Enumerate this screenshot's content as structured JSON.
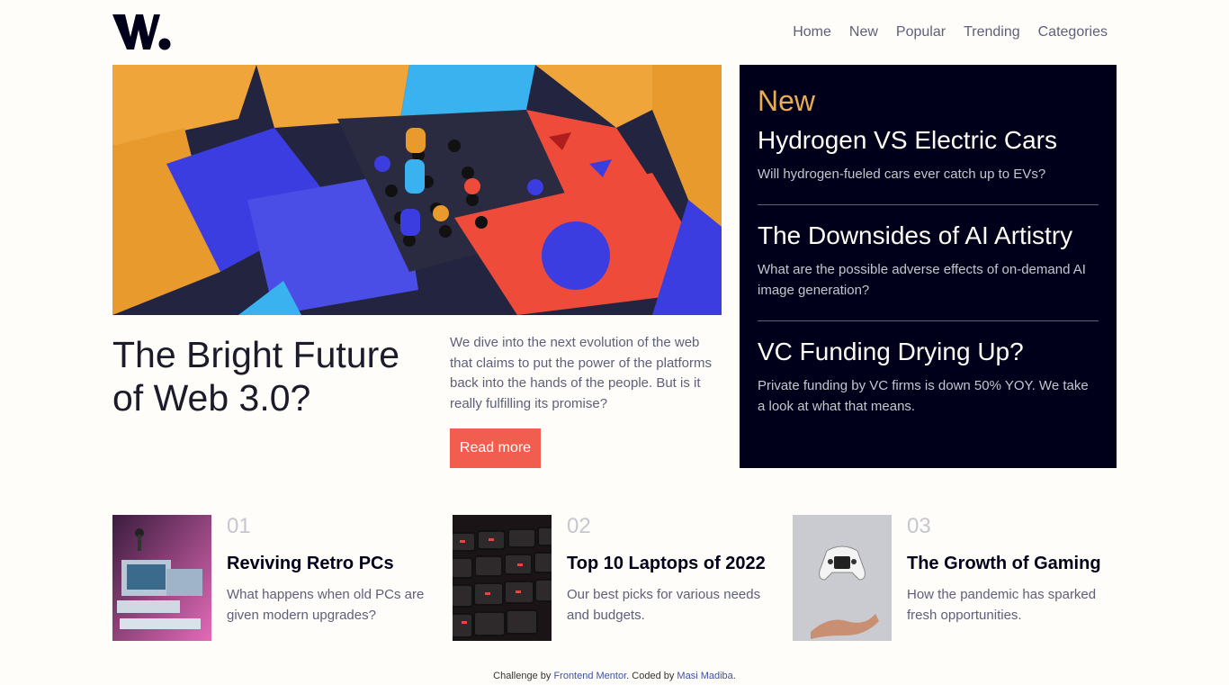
{
  "brand": {
    "logo_text": "W."
  },
  "nav": {
    "items": [
      "Home",
      "New",
      "Popular",
      "Trending",
      "Categories"
    ]
  },
  "hero": {
    "title": "The Bright Future of Web 3.0?",
    "description": "We dive into the next evolution of the web that claims to put the power of the platforms back into the hands of the people. But is it really fulfilling its promise?",
    "button": "Read more"
  },
  "new_section": {
    "heading": "New",
    "items": [
      {
        "title": "Hydrogen VS Electric Cars",
        "text": "Will hydrogen-fueled cars ever catch up to EVs?"
      },
      {
        "title": "The Downsides of AI Artistry",
        "text": "What are the possible adverse effects of on-demand AI image generation?"
      },
      {
        "title": "VC Funding Drying Up?",
        "text": "Private funding by VC firms is down 50% YOY. We take a look at what that means."
      }
    ]
  },
  "cards": [
    {
      "num": "01",
      "title": "Reviving Retro PCs",
      "text": "What happens when old PCs are given modern upgrades?"
    },
    {
      "num": "02",
      "title": "Top 10 Laptops of 2022",
      "text": "Our best picks for various needs and budgets."
    },
    {
      "num": "03",
      "title": "The Growth of Gaming",
      "text": "How the pandemic has sparked fresh opportunities."
    }
  ],
  "footer": {
    "prefix": "Challenge by ",
    "link1": "Frontend Mentor",
    "middle": ". Coded by ",
    "link2": "Masi Madiba",
    "suffix": "."
  },
  "colors": {
    "accent": "#f15e50",
    "gold": "#e9ab53",
    "dark": "#00001a",
    "muted": "#5e607a",
    "bg": "#fffdf9"
  }
}
